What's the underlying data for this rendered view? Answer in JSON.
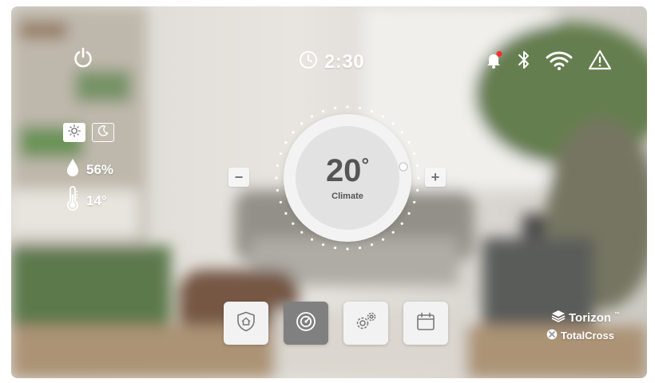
{
  "header": {
    "power_icon": "power-icon",
    "time": "2:30",
    "clock_icon": "clock-icon",
    "status_icons": [
      "bell-icon",
      "bluetooth-icon",
      "wifi-icon",
      "warning-icon"
    ],
    "notification_dot_color": "#ff2a2a"
  },
  "sidebar": {
    "modes": [
      {
        "icon": "sun-icon",
        "active": true
      },
      {
        "icon": "moon-icon",
        "active": false
      }
    ],
    "humidity": "56%",
    "temperature": "14°"
  },
  "dial": {
    "value": "20",
    "degree": "°",
    "label": "Climate",
    "decrement": "−",
    "increment": "+"
  },
  "tabs": [
    {
      "icon": "home-shield-icon",
      "active": false
    },
    {
      "icon": "thermostat-icon",
      "active": true
    },
    {
      "icon": "settings-gears-icon",
      "active": false
    },
    {
      "icon": "calendar-icon",
      "active": false
    }
  ],
  "branding": {
    "torizon": "Torizon",
    "torizon_tm": "™",
    "totalcross": "TotalCross"
  }
}
